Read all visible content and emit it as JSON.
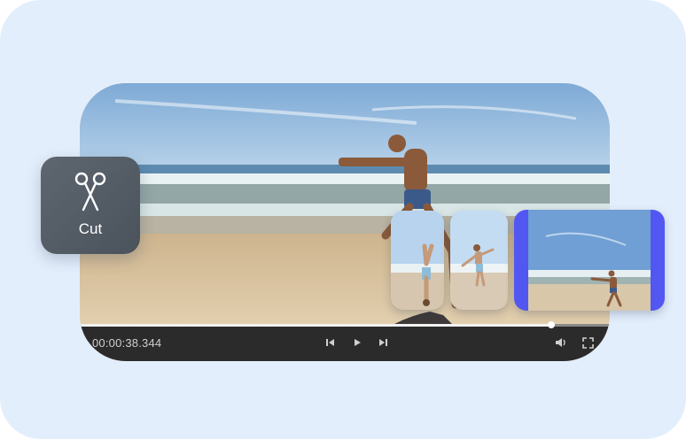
{
  "player": {
    "timecode": "00:00:38.344",
    "progress": 0.89
  },
  "cut_tool": {
    "label": "Cut",
    "icon": "scissors-icon"
  },
  "controls": {
    "prev_icon": "previous-frame-icon",
    "play_icon": "play-icon",
    "next_icon": "next-frame-icon",
    "volume_icon": "volume-icon",
    "fullscreen_icon": "fullscreen-icon"
  },
  "colors": {
    "background": "#e3eefc",
    "cut_tile": "#555d66",
    "control_bar": "#2b2b2b",
    "selected_clip_border": "#5257f2"
  },
  "clips": [
    {
      "name": "clip-handstand"
    },
    {
      "name": "clip-jump"
    },
    {
      "name": "clip-beach-wide",
      "selected": true
    }
  ]
}
